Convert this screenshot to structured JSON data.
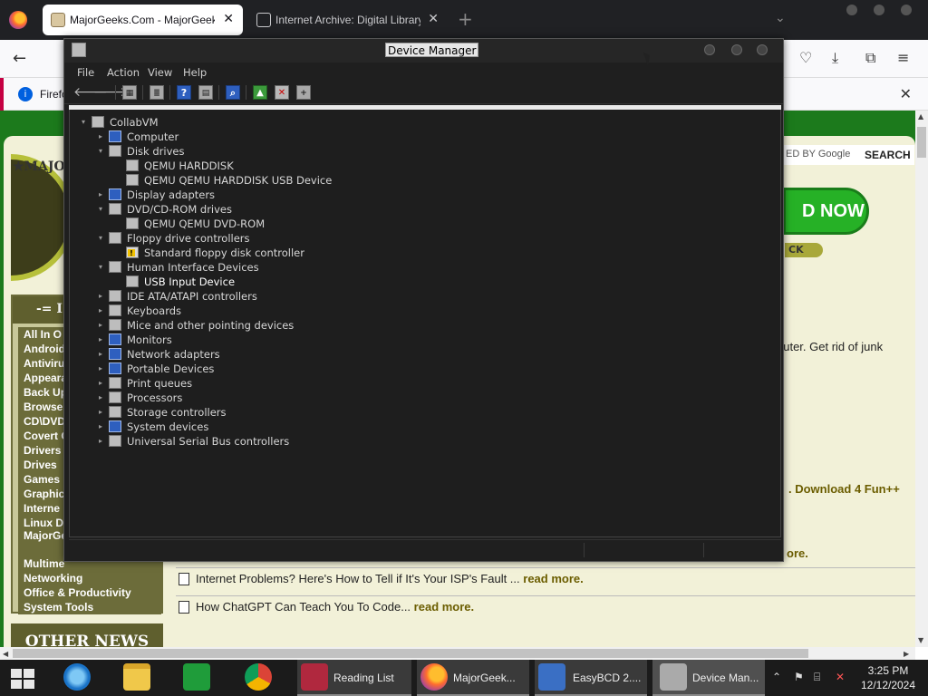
{
  "browser": {
    "tabs": [
      {
        "title": "MajorGeeks.Com - MajorGeeks",
        "close": "✕"
      },
      {
        "title": "Internet Archive: Digital Library of F",
        "close": "✕"
      }
    ],
    "new_tab": "+",
    "notification": "Firefo",
    "notification_close": "✕"
  },
  "webpage": {
    "logo_text": "★MAJO",
    "categories_title": "-= I",
    "categories": [
      "All In O",
      "Android",
      "Antiviru",
      "Appeara",
      "Back Up",
      "Browser",
      "CD\\DVD",
      "Covert O",
      "Drivers",
      "Drives",
      "Games",
      "Graphic",
      "Interne",
      "Linux D",
      "MajorGe Tweaks",
      "Multime",
      "Networking",
      "Office & Productivity",
      "System Tools"
    ],
    "other_news": "OTHER NEWS",
    "search_powered": "ED BY Google",
    "search_label": "SEARCH",
    "cta": "D NOW",
    "cta_sub": "CK",
    "fragment_1": "puter. Get rid of junk",
    "fragment_2": ". Download 4 Fun++",
    "fragment_3": "ore.",
    "news": [
      {
        "text": "Internet Problems? Here's How to Tell if It's Your ISP's Fault ...",
        "more": "read more."
      },
      {
        "text": "How ChatGPT Can Teach You To Code...",
        "more": "read more."
      }
    ]
  },
  "devmgr": {
    "title": "Device Manager",
    "menu": [
      "File",
      "Action",
      "View",
      "Help"
    ],
    "tree": {
      "root": "CollabVM",
      "items": [
        {
          "label": "Computer",
          "expander": "▸"
        },
        {
          "label": "Disk drives",
          "expander": "▾"
        },
        {
          "label": "QEMU HARDDISK"
        },
        {
          "label": "QEMU QEMU HARDDISK USB Device"
        },
        {
          "label": "Display adapters",
          "expander": "▸"
        },
        {
          "label": "DVD/CD-ROM drives",
          "expander": "▾"
        },
        {
          "label": "QEMU QEMU DVD-ROM"
        },
        {
          "label": "Floppy drive controllers",
          "expander": "▾"
        },
        {
          "label": "Standard floppy disk controller"
        },
        {
          "label": "Human Interface Devices",
          "expander": "▾"
        },
        {
          "label": "USB Input Device"
        },
        {
          "label": "IDE ATA/ATAPI controllers",
          "expander": "▸"
        },
        {
          "label": "Keyboards",
          "expander": "▸"
        },
        {
          "label": "Mice and other pointing devices",
          "expander": "▸"
        },
        {
          "label": "Monitors",
          "expander": "▸"
        },
        {
          "label": "Network adapters",
          "expander": "▸"
        },
        {
          "label": "Portable Devices",
          "expander": "▸"
        },
        {
          "label": "Print queues",
          "expander": "▸"
        },
        {
          "label": "Processors",
          "expander": "▸"
        },
        {
          "label": "Storage controllers",
          "expander": "▸"
        },
        {
          "label": "System devices",
          "expander": "▸"
        },
        {
          "label": "Universal Serial Bus controllers",
          "expander": "▸"
        }
      ]
    }
  },
  "taskbar": {
    "items": [
      {
        "label": "Reading List"
      },
      {
        "label": "MajorGeek..."
      },
      {
        "label": "EasyBCD 2...."
      },
      {
        "label": "Device Man..."
      }
    ],
    "clock_time": "3:25 PM",
    "clock_date": "12/12/2024"
  }
}
